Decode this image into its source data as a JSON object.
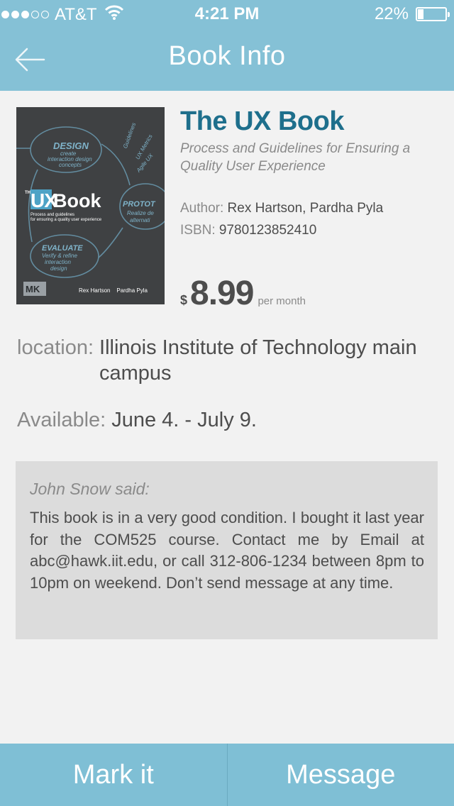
{
  "status_bar": {
    "signal_bars_filled": 3,
    "signal_bars_total": 5,
    "carrier": "AT&T",
    "time": "4:21 PM",
    "battery_percent_label": "22%",
    "battery_level": 0.22
  },
  "nav": {
    "title": "Book Info",
    "back_icon": "arrow-left-icon"
  },
  "book": {
    "cover": {
      "image_desc": "The UX Book cover",
      "title_prefix": "THE",
      "title_ux": "UX",
      "title_book": "Book",
      "subtitle_line1": "Process and guidelines",
      "subtitle_line2": "for ensuring a quality user experience",
      "authors": "Rex Hartson    Pardha Pyla",
      "publisher_logo": "MK",
      "sketch_design": "DESIGN",
      "sketch_design_sub1": "create",
      "sketch_design_sub2": "interaction design",
      "sketch_design_sub3": "concepts",
      "sketch_proto": "PROTOT",
      "sketch_proto_sub1": "Realize de",
      "sketch_proto_sub2": "alternati",
      "sketch_evaluate": "EVALUATE",
      "sketch_evaluate_sub1": "Verify & refine",
      "sketch_evaluate_sub2": "interaction",
      "sketch_evaluate_sub3": "design",
      "sketch_guidelines": "Guidelines",
      "sketch_metrics": "UX Metrics",
      "sketch_agile": "Agile UX"
    },
    "title": "The UX Book",
    "subtitle": "Process and Guidelines for Ensuring a Quality User Experience",
    "author_label": "Author:",
    "author": "Rex Hartson, Pardha Pyla",
    "isbn_label": "ISBN:",
    "isbn": "9780123852410",
    "price_currency": "$",
    "price": "8.99",
    "price_period": "per month"
  },
  "details": {
    "location_label": "location:",
    "location": "Illinois Institute of Technology main campus",
    "available_label": "Available:",
    "available": "June 4. - July 9."
  },
  "comment": {
    "author_line": "John Snow said:",
    "text": "This book is in a very good condition. I bought it last year for the COM525 course. Contact me by Email at abc@hawk.iit.edu, or call 312-806-1234 between 8pm to 10pm on weekend. Don’t send message at any time."
  },
  "actions": {
    "mark_label": "Mark it",
    "message_label": "Message"
  },
  "colors": {
    "header": "#85c1d6",
    "title_accent": "#1e6f8c",
    "background": "#f2f2f2",
    "comment_bg": "#dcdcdc",
    "bottom_bar": "#7fbfd5"
  }
}
